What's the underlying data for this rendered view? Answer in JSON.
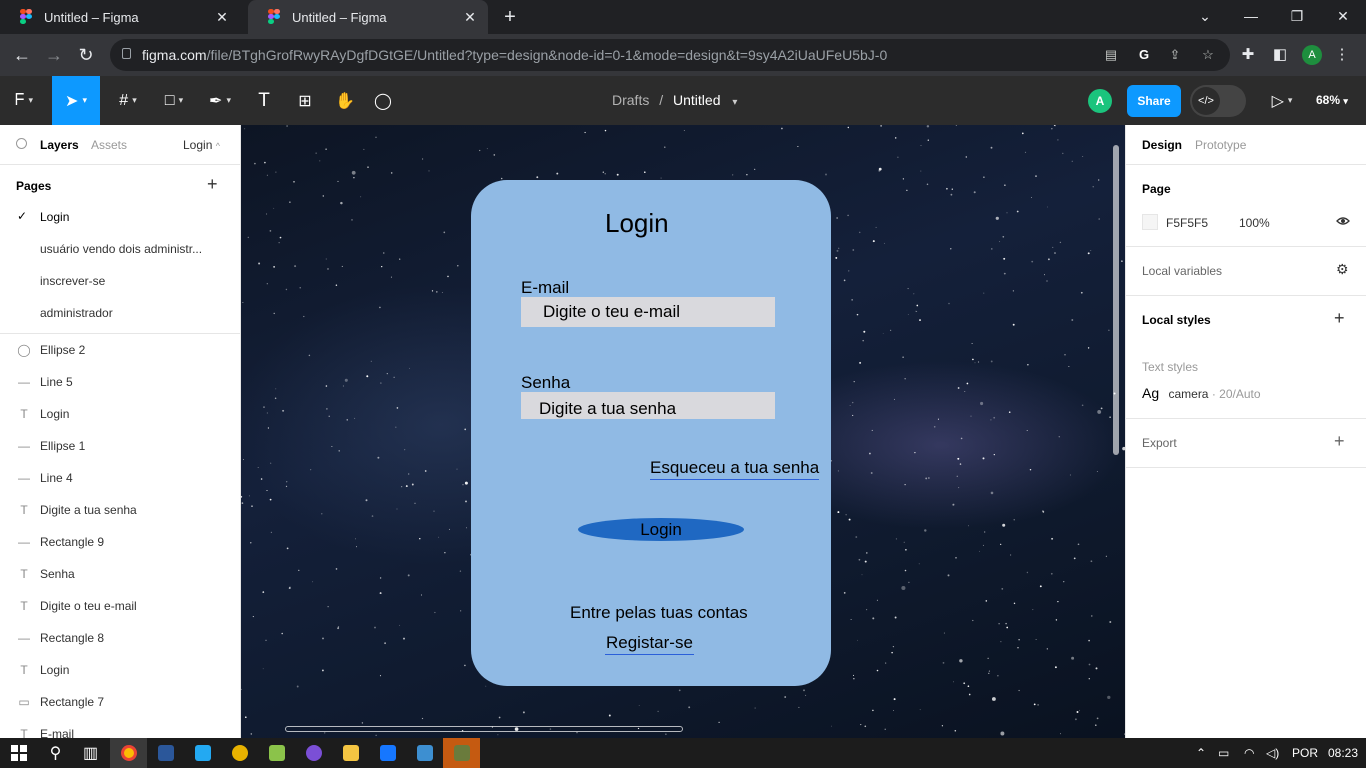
{
  "browser": {
    "tabs": [
      {
        "title": "Untitled – Figma",
        "active": false
      },
      {
        "title": "Untitled – Figma",
        "active": true
      }
    ],
    "url_host": "figma.com",
    "url_path": "/file/BTghGrofRwyRAyDgfDGtGE/Untitled?type=design&node-id=0-1&mode=design&t=9sy4A2iUaUFeU5bJ-0",
    "profile_initial": "A"
  },
  "figma": {
    "breadcrumb_parent": "Drafts",
    "breadcrumb_sep": "/",
    "file_name": "Untitled",
    "avatar_initial": "A",
    "share_label": "Share",
    "zoom": "68%",
    "left_panel": {
      "tab_layers": "Layers",
      "tab_assets": "Assets",
      "current_page": "Login",
      "pages_header": "Pages",
      "pages": [
        {
          "label": "Login",
          "selected": true
        },
        {
          "label": "usuário vendo dois administr...",
          "selected": false
        },
        {
          "label": "inscrever-se",
          "selected": false
        },
        {
          "label": "administrador",
          "selected": false
        }
      ],
      "layers": [
        {
          "icon": "ellipse",
          "label": "Ellipse 2"
        },
        {
          "icon": "line",
          "label": "Line 5"
        },
        {
          "icon": "text",
          "label": "Login"
        },
        {
          "icon": "line",
          "label": "Ellipse 1"
        },
        {
          "icon": "line",
          "label": "Line 4"
        },
        {
          "icon": "text",
          "label": "Digite a tua senha"
        },
        {
          "icon": "line",
          "label": "Rectangle 9"
        },
        {
          "icon": "text",
          "label": "Senha"
        },
        {
          "icon": "text",
          "label": "Digite o teu e-mail"
        },
        {
          "icon": "line",
          "label": "Rectangle 8"
        },
        {
          "icon": "text",
          "label": "Login"
        },
        {
          "icon": "rect",
          "label": "Rectangle 7"
        },
        {
          "icon": "text",
          "label": "E-mail"
        }
      ]
    },
    "right_panel": {
      "tab_design": "Design",
      "tab_prototype": "Prototype",
      "page_header": "Page",
      "page_color": "F5F5F5",
      "page_opacity": "100%",
      "local_variables": "Local variables",
      "local_styles": "Local styles",
      "text_styles_label": "Text styles",
      "text_style_sample": "Ag",
      "text_style_name": "camera",
      "text_style_meta": "· 20/Auto",
      "export_label": "Export"
    },
    "help_label": "?"
  },
  "design_frame": {
    "title": "Login",
    "email_label": "E-mail",
    "email_placeholder": "Digite o teu e-mail",
    "password_label": "Senha",
    "password_placeholder": "Digite a tua senha",
    "forgot_link": "Esqueceu a tua senha",
    "login_button": "Login",
    "enter_text": "Entre pelas tuas contas",
    "register_link": "Registar-se",
    "frame_color": "#90bae4",
    "button_color": "#1f68c2"
  },
  "taskbar": {
    "language": "POR",
    "time": "08:23"
  }
}
